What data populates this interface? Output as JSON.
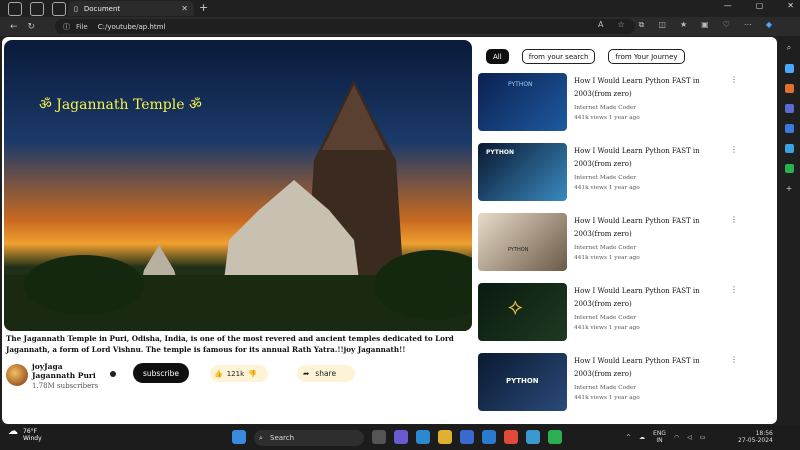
{
  "browser": {
    "tab_title": "Document",
    "url_scheme": "File",
    "url": "C:/youtube/ap.html"
  },
  "video": {
    "overlay_title": "ॐ Jagannath Temple ॐ",
    "description": "The Jagannath Temple in Puri, Odisha, India, is one of the most revered and ancient temples dedicated to Lord Jagannath, a form of Lord Vishnu. The temple is famous for its annual Rath Yatra.!!joy Jagannath!!",
    "channel": "joyJaga Jagannath Puri",
    "subscribers": "1.78M subscribers",
    "subscribe_label": "subscribe",
    "likes": "121k",
    "share_label": "share"
  },
  "filters": [
    "All",
    "from your search",
    "from Your Journey"
  ],
  "recommendations": [
    {
      "title": "How I Would Learn Python FAST in 2003(from zero)",
      "channel": "Internet Made Coder",
      "meta": "441k views 1 year ago",
      "thumb_label": "PYTHON"
    },
    {
      "title": "How I Would Learn Python FAST in 2003(from zero)",
      "channel": "Internet Made Coder",
      "meta": "441k views 1 year ago",
      "thumb_label": "PYTHON"
    },
    {
      "title": "How I Would Learn Python FAST in 2003(from zero)",
      "channel": "Internet Made Coder",
      "meta": "441k views 1 year ago",
      "thumb_label": "PYTHON"
    },
    {
      "title": "How I Would Learn Python FAST in 2003(from zero)",
      "channel": "Internet Made Coder",
      "meta": "441k views 1 year ago",
      "thumb_label": ""
    },
    {
      "title": "How I Would Learn Python FAST in 2003(from zero)",
      "channel": "Internet Made Coder",
      "meta": "441k views 1 year ago",
      "thumb_label": "PYTHON"
    }
  ],
  "taskbar": {
    "temperature": "76°F",
    "weather": "Windy",
    "search_label": "Search",
    "lang_top": "ENG",
    "lang_bottom": "IN",
    "time": "18:56",
    "date": "27-05-2024"
  }
}
